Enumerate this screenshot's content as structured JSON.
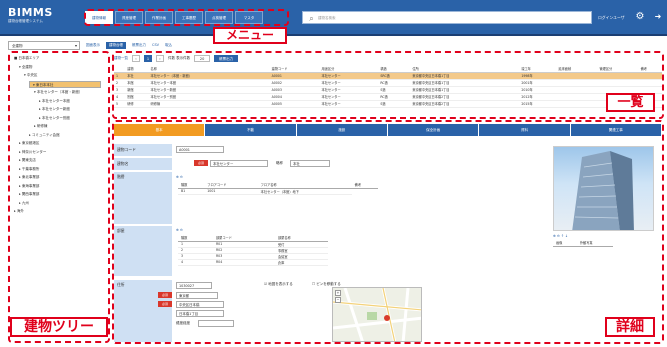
{
  "header": {
    "logo": "BIMMS",
    "logo_sub": "建物台帳管理システム",
    "nav": [
      "建物情報",
      "資産管理",
      "作業計画",
      "工事履歴",
      "点検管理",
      "マスタ"
    ],
    "search_placeholder": "建物名検索",
    "user": "ログインユーザ",
    "colors": {
      "header": "#2a62a8",
      "accent": "#f29b22",
      "callout": "#e0001b"
    }
  },
  "callouts": {
    "menu": "メニュー",
    "list": "一覧",
    "tree": "建物ツリー",
    "detail": "詳細"
  },
  "toolbar": {
    "select_value": "全建物",
    "links": [
      "図面表示",
      "建物台帳",
      "帳票出力",
      "CSV",
      "取込"
    ]
  },
  "tree": [
    {
      "label": "■ 日本橋エリア",
      "depth": 0
    },
    {
      "label": "▾ 全建物",
      "depth": 1
    },
    {
      "label": "▾ 中央区",
      "depth": 2
    },
    {
      "label": "▾ 東日本本社",
      "depth": 3,
      "selected": true
    },
    {
      "label": "▾ 本社センター（本館・新館）",
      "depth": 4
    },
    {
      "label": "▸ 本社センター本館",
      "depth": 5
    },
    {
      "label": "▸ 本社センター新館",
      "depth": 5
    },
    {
      "label": "▸ 本社センター別館",
      "depth": 5
    },
    {
      "label": "▸ 研修棟",
      "depth": 4
    },
    {
      "label": "▸ コミュニティ会館",
      "depth": 3
    },
    {
      "label": "▸ 東京都港区",
      "depth": 1
    },
    {
      "label": "▸ 神奈川センター",
      "depth": 1
    },
    {
      "label": "▸ 関東支店",
      "depth": 1
    },
    {
      "label": "▸ 千葉事務所",
      "depth": 1
    },
    {
      "label": "▸ 東北事業部",
      "depth": 1
    },
    {
      "label": "▸ 東海事業部",
      "depth": 1
    },
    {
      "label": "▸ 関西事業部",
      "depth": 1
    },
    {
      "label": "▸ 九州",
      "depth": 1
    },
    {
      "label": "▸ 海外",
      "depth": 0
    }
  ],
  "list": {
    "title": "建物一覧",
    "pager": {
      "current": "1",
      "total_label": "件数 表示件数",
      "per_page": "20",
      "btn": "帳票出力"
    },
    "columns": [
      "",
      "建物",
      "名称",
      "建物コード",
      "用途区分",
      "構造",
      "住所",
      "竣工年",
      "延床面積",
      "管理区分",
      "備考"
    ],
    "rows": [
      [
        "1",
        "本社",
        "本社センター（本館・新館）",
        "A0001",
        "本社センター",
        "SRC造",
        "東京都中央区日本橋1丁目",
        "1998年",
        "",
        "",
        ""
      ],
      [
        "2",
        "本館",
        "本社センター本館",
        "A0002",
        "本社センター",
        "RC造",
        "東京都中央区日本橋1丁目",
        "2001年",
        "",
        "",
        ""
      ],
      [
        "3",
        "新館",
        "本社センター新館",
        "A0003",
        "本社センター",
        "S造",
        "東京都中央区日本橋1丁目",
        "2010年",
        "",
        "",
        ""
      ],
      [
        "4",
        "別館",
        "本社センター別館",
        "A0004",
        "本社センター",
        "RC造",
        "東京都中央区日本橋2丁目",
        "2012年",
        "",
        "",
        ""
      ],
      [
        "5",
        "研修",
        "研修棟",
        "A0005",
        "本社センター",
        "S造",
        "東京都中央区日本橋2丁目",
        "2015年",
        "",
        "",
        ""
      ]
    ]
  },
  "detail": {
    "tabs": [
      "基本",
      "不動",
      "施設",
      "保全計画",
      "資料",
      "関連工事"
    ],
    "fields": {
      "code_label": "建物コード",
      "code_value": "A0001",
      "name_label": "建物名",
      "name_value": "本社センター",
      "kana_label": "略称",
      "kana_value": "本社",
      "floor_label": "階層",
      "floor_cols": [
        "階数",
        "フロアコード",
        "フロア名称",
        "備考"
      ],
      "floor_rows": [
        [
          "B1",
          "1001",
          "本社センター（本館）地下"
        ]
      ],
      "room_label": "部屋",
      "room_cols": [
        "階数",
        "部屋コード",
        "部屋名称"
      ],
      "room_rows": [
        [
          "1",
          "R01",
          "受付"
        ],
        [
          "2",
          "R02",
          "事務室"
        ],
        [
          "3",
          "R03",
          "会議室"
        ],
        [
          "4",
          "R04",
          "倉庫"
        ]
      ],
      "addr_label": "住所",
      "zip": "1030027",
      "pref": "東京都",
      "city": "中央区日本橋",
      "addr_detail": "日本橋1丁目",
      "geo_label": "緯度経度",
      "map_check": "地図を表示する",
      "map_check2": "ピンを移動する",
      "photo_caption": "外観写真"
    }
  }
}
